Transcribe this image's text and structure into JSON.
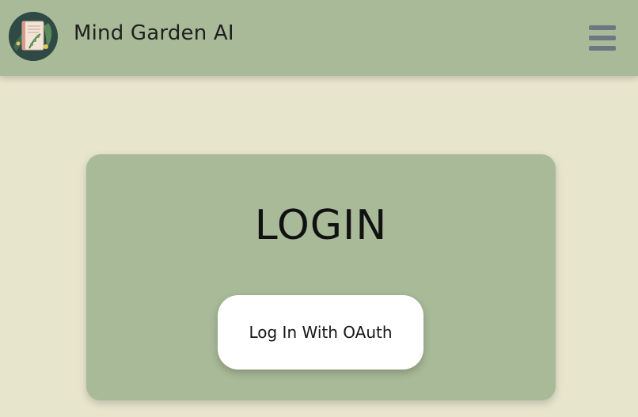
{
  "navbar": {
    "brand": "Mind Garden AI",
    "logo_icon": "journal-plant-logo-icon",
    "menu_icon": "hamburger-menu-icon"
  },
  "login": {
    "title": "LOGIN",
    "oauth_button_label": "Log In With OAuth"
  },
  "colors": {
    "page_background": "#e8e5cd",
    "sage": "#a8ba98",
    "menu_icon": "#6d7783",
    "button_background": "#ffffff",
    "text": "#111111"
  }
}
